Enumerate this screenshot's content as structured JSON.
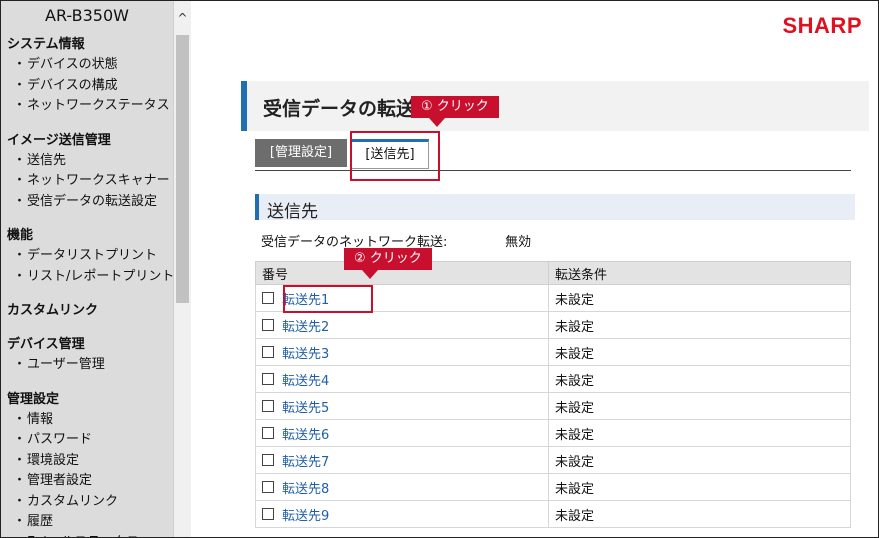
{
  "device": "AR-B350W",
  "brand": "SHARP",
  "sidebar": {
    "groups": [
      {
        "title": "システム情報",
        "items": [
          "デバイスの状態",
          "デバイスの構成",
          "ネットワークステータス"
        ]
      },
      {
        "title": "イメージ送信管理",
        "items": [
          "送信先",
          "ネットワークスキャナー",
          "受信データの転送設定"
        ]
      },
      {
        "title": "機能",
        "items": [
          "データリストプリント",
          "リスト/レポートプリント"
        ]
      },
      {
        "title": "カスタムリンク",
        "items": []
      },
      {
        "title": "デバイス管理",
        "items": [
          "ユーザー管理"
        ]
      },
      {
        "title": "管理設定",
        "items": [
          "情報",
          "パスワード",
          "環境設定",
          "管理者設定",
          "カスタムリンク",
          "履歴",
          "Eメールステータス"
        ]
      }
    ]
  },
  "page": {
    "title": "受信データの転送設定"
  },
  "tabs": [
    {
      "label": "[管理設定]"
    },
    {
      "label": "[送信先]"
    }
  ],
  "section": {
    "title": "送信先"
  },
  "network_forward": {
    "label": "受信データのネットワーク転送:",
    "value": "無効"
  },
  "table": {
    "headers": [
      "番号",
      "転送条件"
    ],
    "rows": [
      {
        "name": "転送先1",
        "condition": "未設定"
      },
      {
        "name": "転送先2",
        "condition": "未設定"
      },
      {
        "name": "転送先3",
        "condition": "未設定"
      },
      {
        "name": "転送先4",
        "condition": "未設定"
      },
      {
        "name": "転送先5",
        "condition": "未設定"
      },
      {
        "name": "転送先6",
        "condition": "未設定"
      },
      {
        "name": "転送先7",
        "condition": "未設定"
      },
      {
        "name": "転送先8",
        "condition": "未設定"
      },
      {
        "name": "転送先9",
        "condition": "未設定"
      }
    ]
  },
  "annotations": {
    "step1": "① クリック",
    "step2": "② クリック"
  },
  "colors": {
    "accent": "#1f6fb2",
    "brand": "#e01020",
    "annotation": "#c8102e"
  }
}
